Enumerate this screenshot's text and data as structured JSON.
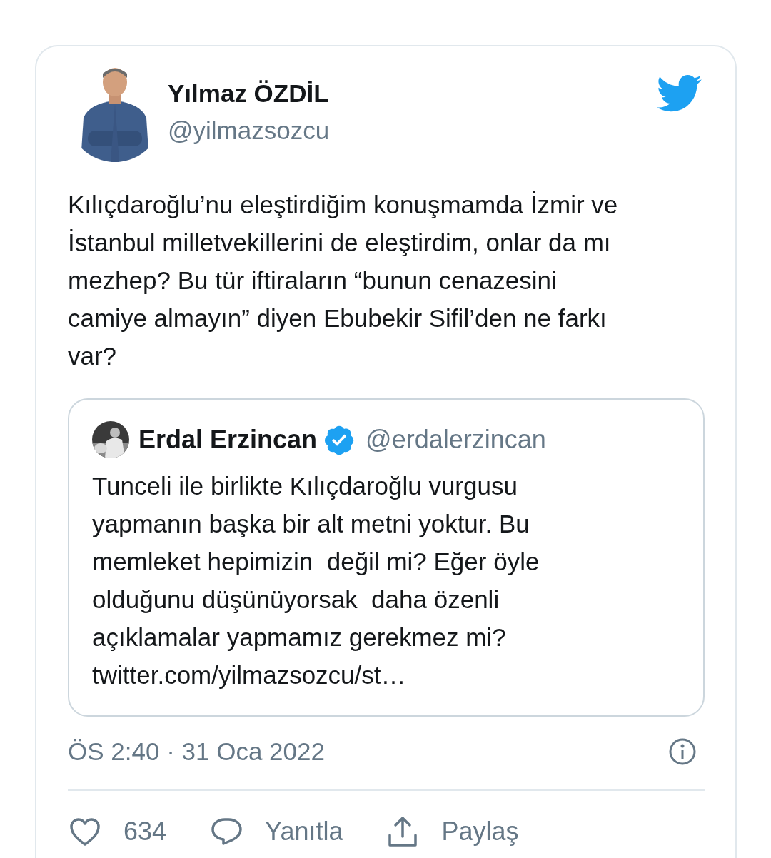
{
  "tweet": {
    "author": {
      "name": "Yılmaz ÖZDİL",
      "handle": "@yilmazsozcu"
    },
    "text_lines": [
      "Kılıçdaroğlu’nu eleştirdiğim konuşmamda İzmir ve",
      "İstanbul milletvekillerini de eleştirdim, onlar da mı",
      "mezhep? Bu tür iftiraların “bunun cenazesini",
      "camiye almayın” diyen Ebubekir Sifil’den ne farkı",
      "var?"
    ],
    "quote": {
      "name": "Erdal Erzincan",
      "verified": true,
      "handle": "@erdalerzincan",
      "text_lines": [
        "Tunceli ile birlikte Kılıçdaroğlu vurgusu",
        "yapmanın başka bir alt metni yoktur. Bu",
        "memleket hepimizin  değil mi? Eğer öyle",
        "olduğunu düşünüyorsak  daha özenli",
        "açıklamalar yapmamız gerekmez mi?",
        "twitter.com/yilmazsozcu/st…"
      ]
    },
    "timestamp": "ÖS 2:40 · 31 Oca 2022",
    "actions": [
      {
        "kind": "like",
        "label": "634"
      },
      {
        "kind": "reply",
        "label": "Yanıtla"
      },
      {
        "kind": "share",
        "label": "Paylaş"
      }
    ]
  }
}
